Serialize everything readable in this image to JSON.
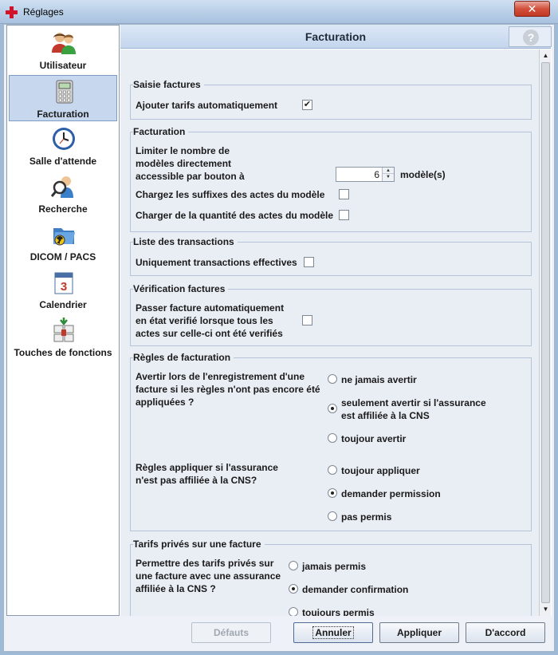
{
  "window": {
    "title": "Réglages",
    "close_label": "✕"
  },
  "sidebar": {
    "items": [
      {
        "label": "Utilisateur",
        "icon": "users-icon"
      },
      {
        "label": "Facturation",
        "icon": "calculator-icon",
        "active": true
      },
      {
        "label": "Salle d'attende",
        "icon": "clock-icon"
      },
      {
        "label": "Recherche",
        "icon": "search-user-icon"
      },
      {
        "label": "DICOM / PACS",
        "icon": "radiation-folder-icon"
      },
      {
        "label": "Calendrier",
        "icon": "calendar-icon"
      },
      {
        "label": "Touches de fonctions",
        "icon": "keyboard-keys-icon"
      }
    ]
  },
  "header": {
    "title": "Facturation",
    "help_label": "?"
  },
  "sections": {
    "saisie": {
      "title": "Saisie factures",
      "auto_tariffs_label": "Ajouter tarifs automatiquement",
      "auto_tariffs_checked": true
    },
    "facturation": {
      "title": "Facturation",
      "limit_label_1": "Limiter le nombre de",
      "limit_label_2": "modèles directement",
      "limit_label_3": "accessible par bouton à",
      "limit_value": "6",
      "limit_unit": "modèle(s)",
      "suffix_label": "Chargez les suffixes des actes du modèle",
      "suffix_checked": false,
      "quantity_label": "Charger de la quantité des actes du modèle",
      "quantity_checked": false
    },
    "transactions": {
      "title": "Liste des transactions",
      "effective_label": "Uniquement transactions effectives",
      "effective_checked": false
    },
    "verification": {
      "title": "Vérification factures",
      "auto_verify_label_1": "Passer facture automatiquement",
      "auto_verify_label_2": "en état verifié lorsque tous les",
      "auto_verify_label_3": "actes sur celle-ci ont été verifiés",
      "auto_verify_checked": false
    },
    "regles": {
      "title": "Règles de facturation",
      "warn_label_1": "Avertir lors de l'enregistrement d'une",
      "warn_label_2": "facture si les règles n'ont pas encore été",
      "warn_label_3": "appliquées ?",
      "warn_options": [
        {
          "label": "ne jamais avertir",
          "selected": false
        },
        {
          "label": "seulement avertir si l'assurance",
          "label2": "est affiliée à la CNS",
          "selected": true
        },
        {
          "label": "toujour avertir",
          "selected": false
        }
      ],
      "apply_label_1": "Règles appliquer si l'assurance",
      "apply_label_2": "n'est pas affiliée à la CNS?",
      "apply_options": [
        {
          "label": "toujour appliquer",
          "selected": false
        },
        {
          "label": "demander permission",
          "selected": true
        },
        {
          "label": "pas permis",
          "selected": false
        }
      ]
    },
    "prives": {
      "title": "Tarifs privés sur une facture",
      "allow_label_1": "Permettre des tarifs privés sur",
      "allow_label_2": "une facture avec une assurance",
      "allow_label_3": "affiliée à la CNS ?",
      "options": [
        {
          "label": "jamais permis",
          "selected": false
        },
        {
          "label": "demander confirmation",
          "selected": true
        },
        {
          "label": "toujours permis",
          "selected": false
        }
      ]
    }
  },
  "buttons": {
    "defaults": "Défauts",
    "cancel": "Annuler",
    "apply": "Appliquer",
    "ok": "D'accord"
  }
}
